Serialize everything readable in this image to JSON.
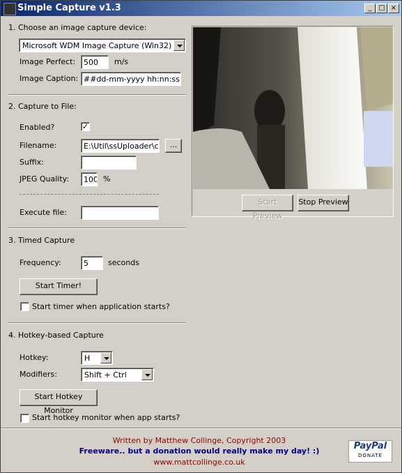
{
  "window": {
    "title": "Simple Capture v1.3"
  },
  "section1": {
    "heading": "1. Choose an image capture device:",
    "device": "Microsoft WDM Image Capture (Win32)",
    "image_perfect_label": "Image Perfect:",
    "image_perfect_value": "500",
    "image_perfect_unit": "m/s",
    "caption_label": "Image Caption:",
    "caption_value": "##dd-mm-yyyy hh:nn:ss##"
  },
  "section2": {
    "heading": "2. Capture to File:",
    "enabled_label": "Enabled?",
    "enabled_mark": "✓",
    "filename_label": "Filename:",
    "filename_value": "E:\\Util\\ssUploader\\car",
    "browse_label": "...",
    "suffix_label": "Suffix:",
    "suffix_value": "",
    "jpeg_label": "JPEG Quality:",
    "jpeg_value": "100",
    "jpeg_unit": "%",
    "execute_label": "Execute file:",
    "execute_value": ""
  },
  "section3": {
    "heading": "3. Timed Capture",
    "frequency_label": "Frequency:",
    "frequency_value": "5",
    "frequency_unit": "seconds",
    "start_timer_label": "Start Timer!",
    "autostart_label": "Start timer when application starts?"
  },
  "section4": {
    "heading": "4. Hotkey-based Capture",
    "hotkey_label": "Hotkey:",
    "hotkey_value": "H",
    "modifiers_label": "Modifiers:",
    "modifiers_value": "Shift + Ctrl",
    "start_monitor_label": "Start Hotkey Monitor",
    "autostart_label": "Start hotkey monitor when app starts?"
  },
  "preview": {
    "start_label": "Start Preview",
    "stop_label": "Stop Preview"
  },
  "footer": {
    "credit": "Written by Matthew Collinge, Copyright 2003",
    "donation": "Freeware.. but a donation would really make my day! :)",
    "url": "www.mattcollinge.co.uk",
    "paypal_brand": "PayPal",
    "paypal_action": "DONATE"
  }
}
